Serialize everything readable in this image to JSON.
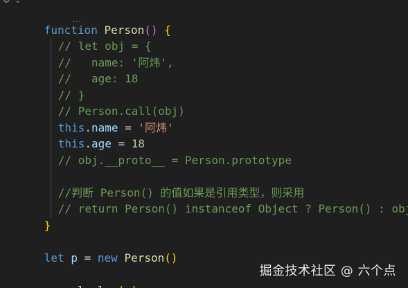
{
  "toolbar": {
    "icons": [
      "gear-icon",
      "chevron-down-icon"
    ],
    "gear_glyph": "⚙",
    "chevron_glyph": "⌄"
  },
  "editor": {
    "hover_dots": "...",
    "lines": {
      "l1": {
        "kw": "function",
        "name": "Person",
        "open": "(",
        "close": ")",
        "brace": "{"
      },
      "l2": "// let obj = {",
      "l3": "//   name: '阿炜',",
      "l4": "//   age: 18",
      "l5": "// }",
      "l6": "// Person.call(obj)",
      "l7": {
        "this": "this",
        "dot": ".",
        "prop": "name",
        "eq": " = ",
        "str": "'阿炜'"
      },
      "l8": {
        "this": "this",
        "dot": ".",
        "prop": "age",
        "eq": " = ",
        "num": "18"
      },
      "l9": "// obj.__proto__ = Person.prototype",
      "l10": "",
      "l11": "//判断 Person() 的值如果是引用类型，则采用",
      "l12": "// return Person() instanceof Object ? Person() : obj",
      "l13": "}",
      "l14": "",
      "l15": {
        "let": "let",
        "var": "p",
        "eq": " = ",
        "new": "new",
        "name": "Person",
        "open": "(",
        "close": ")"
      },
      "l16": "",
      "l17": {
        "obj": "console",
        "dot": ".",
        "method": "log",
        "open": "(",
        "arg": "p",
        "close": ")",
        "semi": ";"
      }
    }
  },
  "watermark": {
    "text": "掘金技术社区 @ 六个点"
  },
  "colors": {
    "background": "#1f1f1f",
    "keyword": "#569cd6",
    "function": "#dcdcaa",
    "variable": "#9cdcfe",
    "comment": "#6a9955",
    "string": "#ce9178",
    "number": "#b5cea8",
    "brace": "#ffd700",
    "paren": "#da70d6"
  }
}
